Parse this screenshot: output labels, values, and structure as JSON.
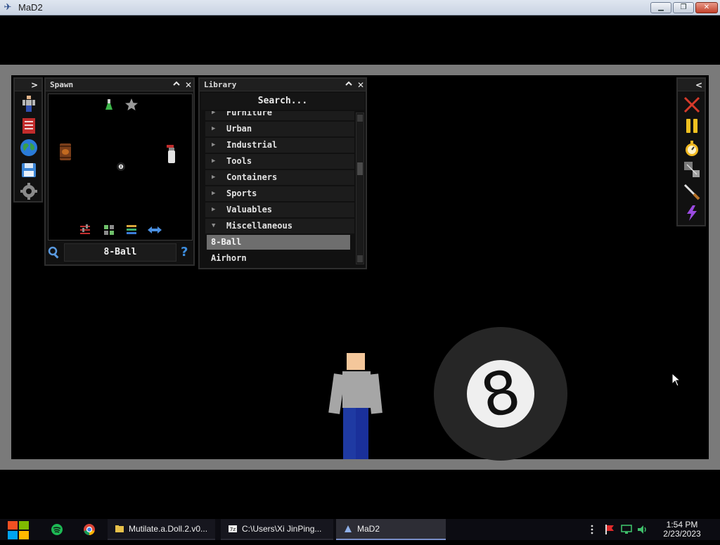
{
  "window": {
    "title": "MaD2",
    "minimize": "▁",
    "restore": "❐",
    "close": "✕"
  },
  "spawn_panel": {
    "title": "Spawn",
    "collapse": "^",
    "close": "✕",
    "selected_item": "8-Ball",
    "help": "?",
    "items": [
      "flask-icon",
      "star-icon",
      "barrel-icon",
      "fire-extinguisher-icon",
      "eight-ball-icon"
    ],
    "tools": [
      "sliders-icon",
      "grid-icon",
      "layers-icon",
      "swap-arrows-icon"
    ]
  },
  "library_panel": {
    "title": "Library",
    "collapse": "^",
    "close": "✕",
    "search_placeholder": "Search...",
    "categories": [
      {
        "label": "Furniture",
        "expanded": false
      },
      {
        "label": "Urban",
        "expanded": false
      },
      {
        "label": "Industrial",
        "expanded": false
      },
      {
        "label": "Tools",
        "expanded": false
      },
      {
        "label": "Containers",
        "expanded": false
      },
      {
        "label": "Sports",
        "expanded": false
      },
      {
        "label": "Valuables",
        "expanded": false
      },
      {
        "label": "Miscellaneous",
        "expanded": true
      }
    ],
    "items": [
      {
        "label": "8-Ball",
        "selected": true
      },
      {
        "label": "Airhorn",
        "selected": false
      }
    ]
  },
  "left_toolbar": {
    "expand": ">",
    "tools": [
      "ragdoll-tool-icon",
      "book-icon",
      "globe-icon",
      "save-icon",
      "settings-gear-icon"
    ]
  },
  "right_toolbar": {
    "collapse": "<",
    "tools": [
      "delete-x-icon",
      "pause-icon",
      "stopwatch-icon",
      "select-shape-icon",
      "knife-icon",
      "lightning-icon"
    ]
  },
  "scene": {
    "ball_number": "8"
  },
  "taskbar": {
    "tasks": [
      {
        "label": "Mutilate.a.Doll.2.v0...",
        "active": false
      },
      {
        "label": "C:\\Users\\Xi JinPing...",
        "active": false
      },
      {
        "label": "MaD2",
        "active": true
      }
    ],
    "clock_time": "1:54 PM",
    "clock_date": "2/23/2023",
    "colors": {
      "taskbar": "#0c0c12",
      "active_task": "#2d2d35"
    }
  }
}
